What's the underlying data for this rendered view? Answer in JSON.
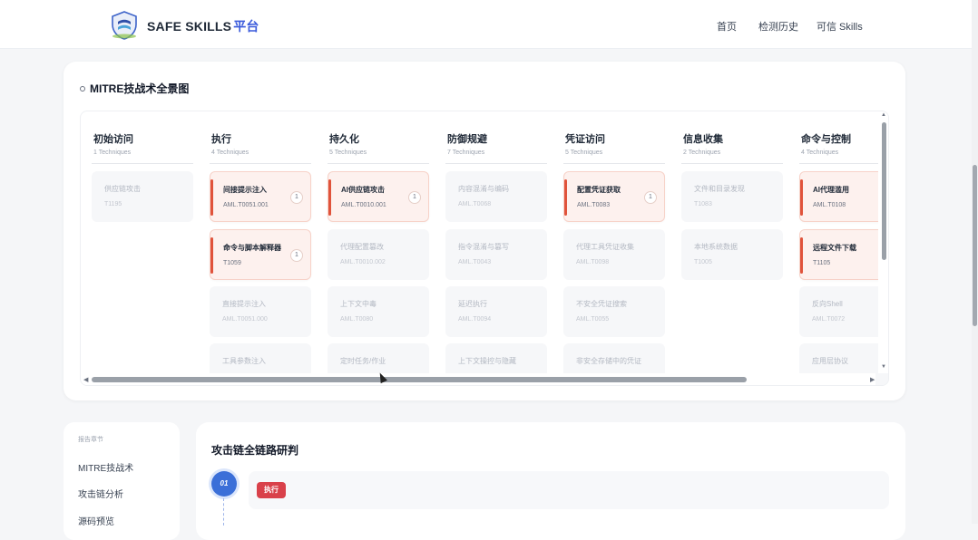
{
  "header": {
    "brand": "SAFE SKILLS",
    "brand_accent": "平台",
    "nav": [
      "首页",
      "检测历史",
      "可信 Skills"
    ]
  },
  "mitre": {
    "title": "MITRE技战术全景图",
    "columns": [
      {
        "name": "初始访问",
        "count": "1 Techniques",
        "techniques": [
          {
            "name": "供应链攻击",
            "id": "T1195",
            "hit": false
          }
        ]
      },
      {
        "name": "执行",
        "count": "4 Techniques",
        "techniques": [
          {
            "name": "间接提示注入",
            "id": "AML.T0051.001",
            "hit": true,
            "badge": "1"
          },
          {
            "name": "命令与脚本解释器",
            "id": "T1059",
            "hit": true,
            "badge": "1"
          },
          {
            "name": "直接提示注入",
            "id": "AML.T0051.000",
            "hit": false
          },
          {
            "name": "工具参数注入",
            "id": "",
            "hit": false
          }
        ]
      },
      {
        "name": "持久化",
        "count": "5 Techniques",
        "techniques": [
          {
            "name": "AI供应链攻击",
            "id": "AML.T0010.001",
            "hit": true,
            "badge": "1"
          },
          {
            "name": "代理配置篡改",
            "id": "AML.T0010.002",
            "hit": false
          },
          {
            "name": "上下文中毒",
            "id": "AML.T0080",
            "hit": false
          },
          {
            "name": "定时任务/作业",
            "id": "",
            "hit": false
          }
        ]
      },
      {
        "name": "防御规避",
        "count": "7 Techniques",
        "techniques": [
          {
            "name": "内容混淆与编码",
            "id": "AML.T0068",
            "hit": false
          },
          {
            "name": "指令混淆与篡写",
            "id": "AML.T0043",
            "hit": false
          },
          {
            "name": "延迟执行",
            "id": "AML.T0094",
            "hit": false
          },
          {
            "name": "上下文操控与隐藏",
            "id": "",
            "hit": false
          }
        ]
      },
      {
        "name": "凭证访问",
        "count": "5 Techniques",
        "techniques": [
          {
            "name": "配置凭证获取",
            "id": "AML.T0083",
            "hit": true,
            "badge": "1"
          },
          {
            "name": "代理工具凭证收集",
            "id": "AML.T0098",
            "hit": false
          },
          {
            "name": "不安全凭证搜索",
            "id": "AML.T0055",
            "hit": false
          },
          {
            "name": "非安全存储中的凭证",
            "id": "",
            "hit": false
          }
        ]
      },
      {
        "name": "信息收集",
        "count": "2 Techniques",
        "techniques": [
          {
            "name": "文件和目录发现",
            "id": "T1083",
            "hit": false
          },
          {
            "name": "本地系统数据",
            "id": "T1005",
            "hit": false
          }
        ]
      },
      {
        "name": "命令与控制",
        "count": "4 Techniques",
        "techniques": [
          {
            "name": "AI代理滥用",
            "id": "AML.T0108",
            "hit": true,
            "badge": ""
          },
          {
            "name": "远程文件下载",
            "id": "T1105",
            "hit": true,
            "badge": ""
          },
          {
            "name": "反向Shell",
            "id": "AML.T0072",
            "hit": false
          },
          {
            "name": "应用层协议",
            "id": "",
            "hit": false
          }
        ]
      }
    ]
  },
  "sidebar": {
    "label": "报告章节",
    "items": [
      "MITRE技战术",
      "攻击链分析",
      "源码预览"
    ]
  },
  "chain": {
    "title": "攻击链全链路研判",
    "step_number": "01",
    "step_tag": "执行"
  },
  "colors": {
    "accent": "#3b5bdb",
    "hit": "#e0533b",
    "tag": "#d9414a",
    "step": "#3b6fd8"
  }
}
